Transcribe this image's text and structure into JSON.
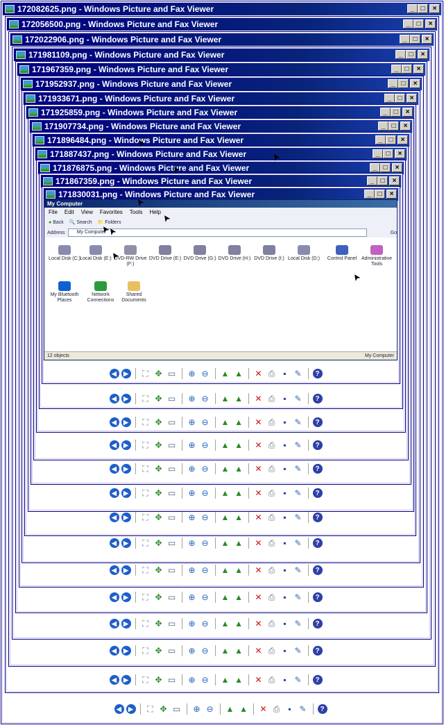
{
  "windows": [
    {
      "title": "172082625.png - Windows Picture and Fax Viewer"
    },
    {
      "title": "172056500.png - Windows Picture and Fax Viewer"
    },
    {
      "title": "172022906.png - Windows Picture and Fax Viewer"
    },
    {
      "title": "171981109.png - Windows Picture and Fax Viewer"
    },
    {
      "title": "171967359.png - Windows Picture and Fax Viewer"
    },
    {
      "title": "171952937.png - Windows Picture and Fax Viewer"
    },
    {
      "title": "171933671.png - Windows Picture and Fax Viewer"
    },
    {
      "title": "171925859.png - Windows Picture and Fax Viewer"
    },
    {
      "title": "171907734.png - Windows Picture and Fax Viewer"
    },
    {
      "title": "171896484.png - Windows Picture and Fax Viewer"
    },
    {
      "title": "171887437.png - Windows Picture and Fax Viewer"
    },
    {
      "title": "171876875.png - Windows Picture and Fax Viewer"
    },
    {
      "title": "171867359.png - Windows Picture and Fax Viewer"
    },
    {
      "title": "171830031.png - Windows Picture and Fax Viewer"
    }
  ],
  "explorer": {
    "title": "My Computer",
    "menu": [
      "File",
      "Edit",
      "View",
      "Favorites",
      "Tools",
      "Help"
    ],
    "address_label": "Address",
    "address_value": "My Computer",
    "go_label": "Go",
    "back_label": "Back",
    "search_label": "Search",
    "folders_label": "Folders",
    "items": [
      "Local Disk (C:)",
      "Local Disk (E:)",
      "DVD-RW Drive (F:)",
      "DVD Drive (E:)",
      "DVD Drive (G:)",
      "DVD Drive (H:)",
      "DVD Drive (I:)",
      "Local Disk (D:)",
      "Control Panel",
      "Administrative Tools",
      "My Bluetooth Places",
      "Network Connections",
      "Shared Documents"
    ],
    "status_left": "12 objects",
    "status_right": "My Computer"
  },
  "toolbar_icons": [
    "previous-image-icon",
    "next-image-icon",
    "best-fit-icon",
    "actual-size-icon",
    "slideshow-icon",
    "zoom-in-icon",
    "zoom-out-icon",
    "rotate-clockwise-icon",
    "rotate-counterclockwise-icon",
    "delete-icon",
    "print-icon",
    "save-icon",
    "edit-icon",
    "help-icon"
  ],
  "caption_buttons": {
    "minimize": "_",
    "maximize": "□",
    "close": "×"
  }
}
